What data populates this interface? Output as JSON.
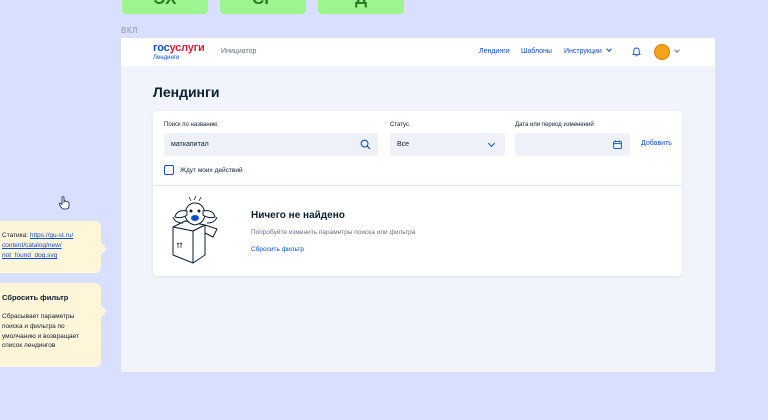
{
  "top_tabs": [
    "ЭХ",
    "СГ",
    "Д"
  ],
  "section_label": "ВКЛ",
  "header": {
    "logo_gos": "гос",
    "logo_uslugi": "услуги",
    "logo_sub": "Лендинги",
    "role": "Инициатор",
    "nav": [
      "Лендинги",
      "Шаблоны",
      "Инструкции"
    ],
    "icons": [
      "bell-icon",
      "avatar",
      "chevron-down-icon"
    ]
  },
  "page_title": "Лендинги",
  "filters": {
    "search_label": "Поиск по названию",
    "search_value": "маткапитал",
    "status_label": "Статус",
    "status_value": "Все",
    "date_label": "Дата или период изменений",
    "date_value": "",
    "add_label": "Добавить",
    "checkbox_label": "Ждут моих действий",
    "checkbox_checked": false
  },
  "empty": {
    "title": "Ничего не найдено",
    "description": "Попробуйте изменить параметры поиска или фильтра",
    "reset_label": "Сбросить фильтр"
  },
  "notes": {
    "static_prefix": "Статика: ",
    "static_url_1": "https://gu-st.ru/",
    "static_url_2": "content/catalog/new/",
    "static_url_3": "not_found_dog.svg",
    "reset_title": "Сбросить фильтр",
    "reset_body_1": "Сбрасывает параметры",
    "reset_body_2": "поиска и фильтра по",
    "reset_body_3": "умолчанию и возвращает",
    "reset_body_4": "список лендингов"
  },
  "colors": {
    "canvas": "#d9e0ff",
    "accent": "#0d4cd3",
    "brand_red": "#e21a37",
    "note_bg": "#fff5d9",
    "tab_green": "#9df58f"
  }
}
